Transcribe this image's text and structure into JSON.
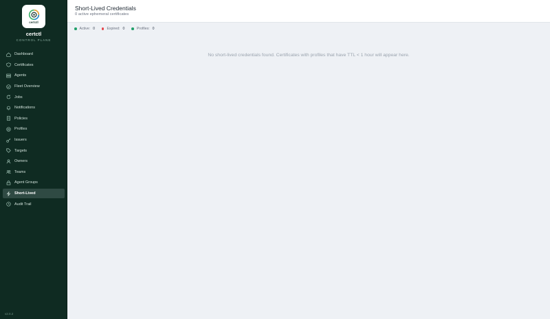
{
  "app": {
    "name": "certctl",
    "subtitle": "CONTROL PLANE",
    "logo_text": "certctl",
    "version": "v2.0.2"
  },
  "sidebar": {
    "items": [
      {
        "label": "Dashboard",
        "icon": "home-icon"
      },
      {
        "label": "Certificates",
        "icon": "shield-icon"
      },
      {
        "label": "Agents",
        "icon": "server-icon"
      },
      {
        "label": "Fleet Overview",
        "icon": "fleet-icon"
      },
      {
        "label": "Jobs",
        "icon": "refresh-icon"
      },
      {
        "label": "Notifications",
        "icon": "bell-icon"
      },
      {
        "label": "Policies",
        "icon": "policy-icon"
      },
      {
        "label": "Profiles",
        "icon": "profile-icon"
      },
      {
        "label": "Issuers",
        "icon": "key-icon"
      },
      {
        "label": "Targets",
        "icon": "tag-icon"
      },
      {
        "label": "Owners",
        "icon": "user-icon"
      },
      {
        "label": "Teams",
        "icon": "team-icon"
      },
      {
        "label": "Agent Groups",
        "icon": "group-icon"
      },
      {
        "label": "Short-Lived",
        "icon": "bolt-icon",
        "active": true
      },
      {
        "label": "Audit Trail",
        "icon": "clock-icon"
      }
    ]
  },
  "header": {
    "title": "Short-Lived Credentials",
    "subtitle": "0 active ephemeral certificates"
  },
  "stats": [
    {
      "label": "Active:",
      "value": "0",
      "color": "#22a06b"
    },
    {
      "label": "Expired:",
      "value": "0",
      "color": "#e5484d"
    },
    {
      "label": "Profiles:",
      "value": "0",
      "color": "#22a06b"
    }
  ],
  "main": {
    "empty_message": "No short-lived credentials found. Certificates with profiles that have TTL < 1 hour will appear here."
  },
  "colors": {
    "sidebar_bg": "#0f2b22",
    "active_item_bg": "#2f4a43",
    "content_bg": "#eef1f5"
  }
}
